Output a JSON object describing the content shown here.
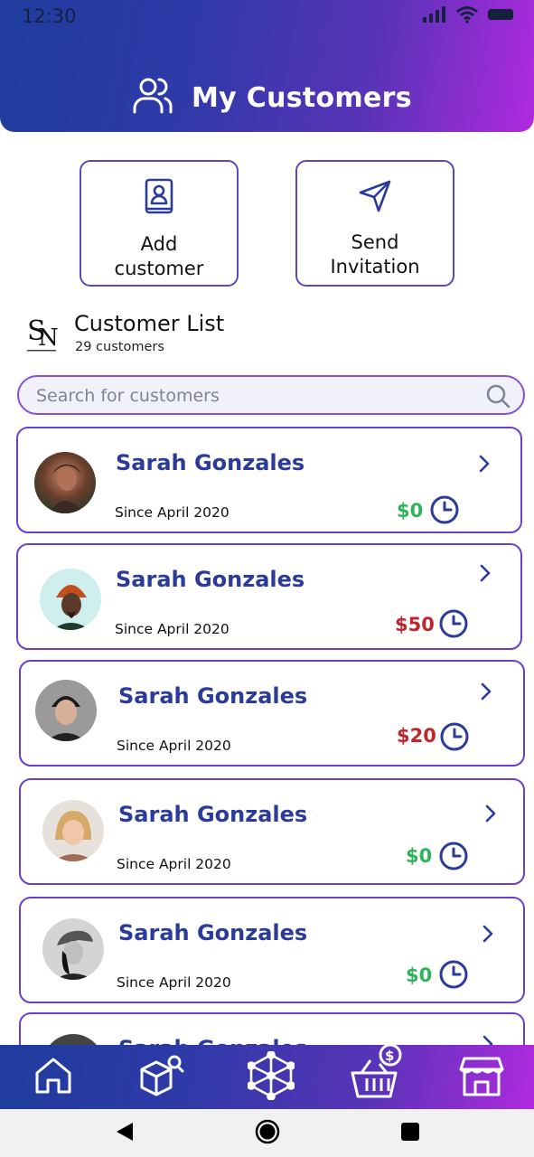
{
  "status_bar": {
    "time": "12:30",
    "icons": [
      "signal-icon",
      "wifi-icon",
      "battery-icon"
    ]
  },
  "header": {
    "title": "My Customers",
    "icon": "users-icon"
  },
  "actions": {
    "add_customer": {
      "line1": "Add",
      "line2": "customer",
      "icon": "contact-book-icon"
    },
    "send_invitation": {
      "line1": "Send",
      "line2": "Invitation",
      "icon": "send-icon"
    }
  },
  "customer_list": {
    "title": "Customer List",
    "count": "29 customers",
    "logo_text": "SN"
  },
  "search": {
    "placeholder": "Search for customers",
    "value": ""
  },
  "customers": [
    {
      "name": "Sarah Gonzales",
      "since": "Since April 2020",
      "amount": "$0",
      "amount_color": "#2db45a"
    },
    {
      "name": "Sarah Gonzales",
      "since": "Since April 2020",
      "amount": "$50",
      "amount_color": "#c0262e"
    },
    {
      "name": "Sarah Gonzales",
      "since": "Since April 2020",
      "amount": "$20",
      "amount_color": "#c0262e"
    },
    {
      "name": "Sarah Gonzales",
      "since": "Since April 2020",
      "amount": "$0",
      "amount_color": "#2db45a"
    },
    {
      "name": "Sarah Gonzales",
      "since": "Since April 2020",
      "amount": "$0",
      "amount_color": "#2db45a"
    },
    {
      "name": "Sarah Gonzales",
      "since": "",
      "amount": "",
      "amount_color": "#2db45a"
    }
  ],
  "bottom_nav": [
    "home-icon",
    "product-search-icon",
    "network-icon",
    "basket-money-icon",
    "store-icon"
  ],
  "colors": {
    "gradient_start": "#1f3c9e",
    "gradient_end": "#b02adf",
    "accent": "#2b3b9a",
    "positive": "#2db45a",
    "negative": "#c0262e"
  }
}
